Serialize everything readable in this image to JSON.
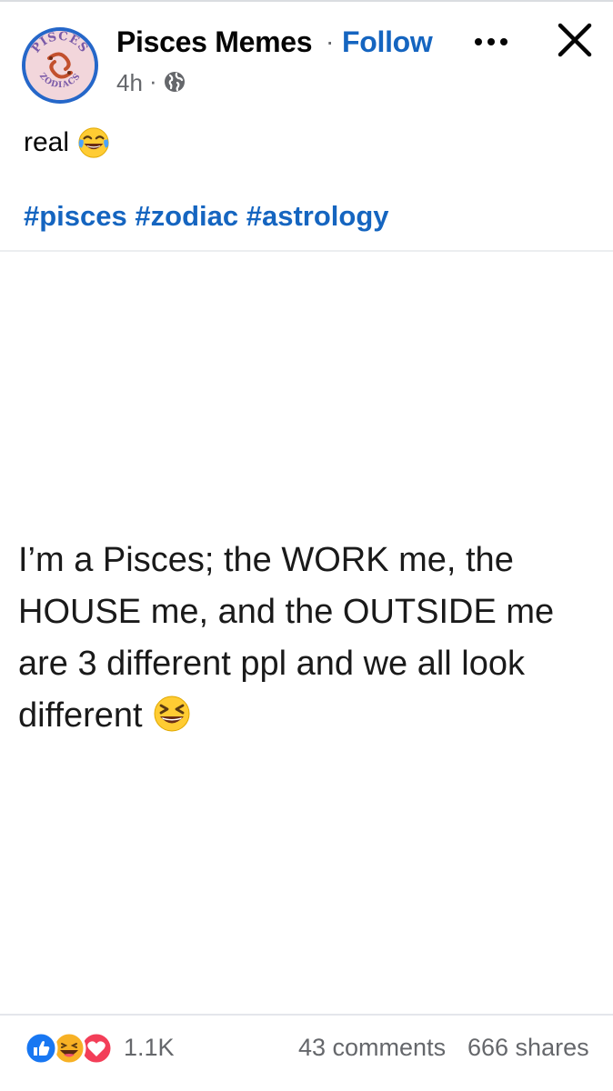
{
  "post": {
    "page_name": "Pisces Memes",
    "separator": "·",
    "follow_label": "Follow",
    "time": "4h",
    "time_separator": "·",
    "avatar_text_top": "PISCES",
    "avatar_text_bottom": "ZODIACS",
    "caption": "real",
    "caption_emoji": "face-with-tears-of-joy",
    "hashtags": [
      "#pisces",
      "#zodiac",
      "#astrology"
    ],
    "image_text": "I’m a Pisces; the WORK me, the HOUSE me, and the OUTSIDE me are 3 different ppl and we all look different",
    "image_emoji": "grinning-squinting-face"
  },
  "footer": {
    "reactions": [
      "like",
      "haha",
      "love"
    ],
    "reaction_count": "1.1K",
    "comments": "43 comments",
    "shares": "666 shares"
  },
  "colors": {
    "accent": "#1565c0",
    "secondary_text": "#65676b",
    "like_blue": "#1877f2",
    "love_red": "#f33e58",
    "haha_yellow": "#f7b125"
  },
  "icons": [
    "globe-icon",
    "more-options-icon",
    "close-icon"
  ]
}
